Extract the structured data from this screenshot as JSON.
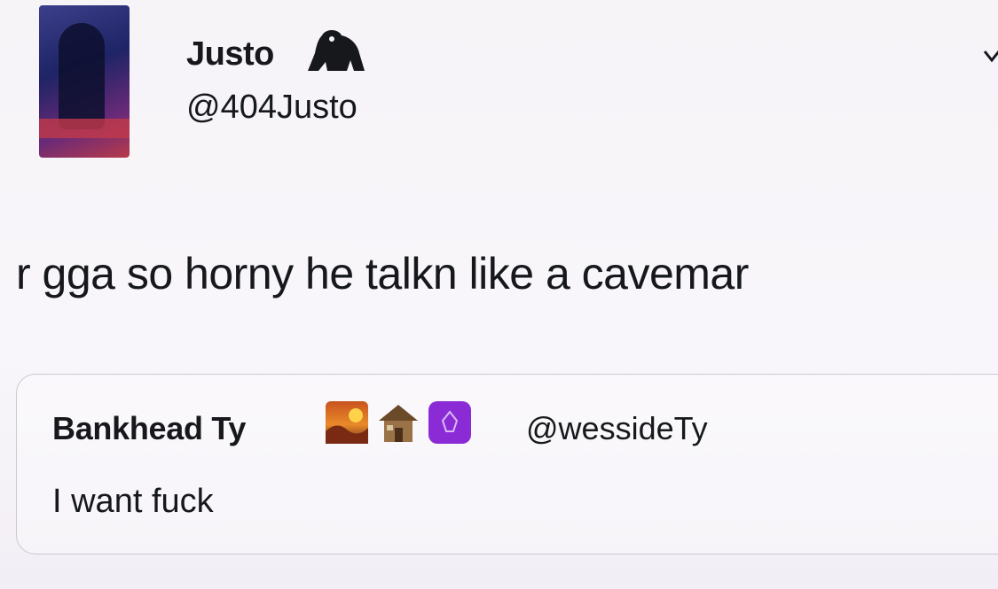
{
  "tweet": {
    "display_name": "Justo",
    "badge_icon": "gorilla-icon",
    "handle": "@404Justo",
    "text": "r gga so horny he talkn like a cavemar"
  },
  "quote": {
    "display_name": "Bankhead Ty",
    "emojis": [
      "sunset-icon",
      "house-icon",
      "purple-square-icon"
    ],
    "handle": "@wessideTy",
    "text": "I want fuck"
  },
  "colors": {
    "text": "#16181c",
    "border": "#c9c9cf",
    "background": "#f6f4f7"
  }
}
